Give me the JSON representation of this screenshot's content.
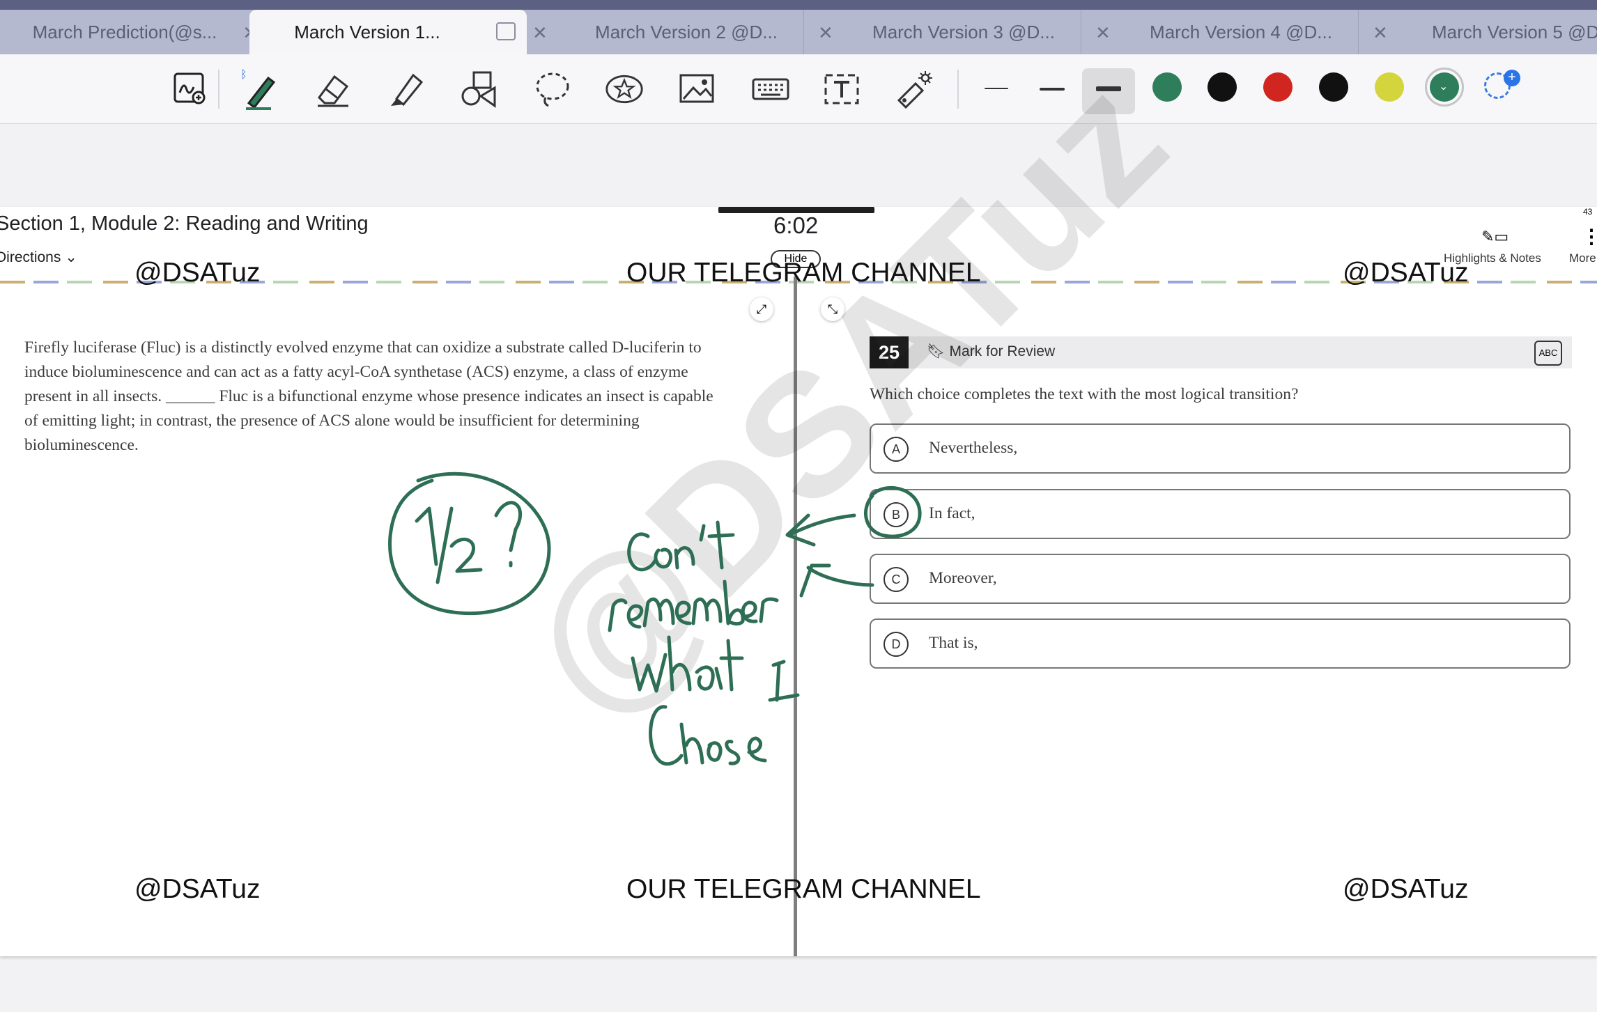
{
  "tabs": [
    {
      "label": "March Prediction(@s...",
      "active": false
    },
    {
      "label": "March Version 1...",
      "active": true
    },
    {
      "label": "March Version 2 @D...",
      "active": false
    },
    {
      "label": "March Version 3 @D...",
      "active": false
    },
    {
      "label": "March Version 4 @D...",
      "active": false
    },
    {
      "label": "March Version 5 @D",
      "active": false
    }
  ],
  "toolbar": {
    "tools": [
      "lasso-handwriting-icon",
      "pen-icon",
      "eraser-icon",
      "highlighter-icon",
      "shapes-icon",
      "lasso-icon",
      "sticker-icon",
      "image-icon",
      "keyboard-icon",
      "text-icon",
      "laser-pointer-icon"
    ],
    "colors": [
      "#2e7d5b",
      "#111111",
      "#d0261f",
      "#111111",
      "#d4d43c",
      "#2e7d5b"
    ],
    "selected_color": "#2e7d5b"
  },
  "exam": {
    "section_title": "Section 1, Module 2: Reading and Writing",
    "directions": "Directions",
    "timer": "6:02",
    "hide": "Hide",
    "highlights_notes": "Highlights & Notes",
    "more": "More",
    "page_num": "43"
  },
  "passage": "Firefly luciferase (Fluc) is a distinctly evolved enzyme that can oxidize a substrate called D-luciferin to induce bioluminescence and can act as a fatty acyl-CoA synthetase (ACS) enzyme, a class of enzyme present in all insects. ______ Fluc is a bifunctional enzyme whose presence indicates an insect is capable of emitting light; in contrast, the presence of ACS alone would be insufficient for determining bioluminescence.",
  "question": {
    "number": "25",
    "mark_for_review": "Mark for Review",
    "abc": "ABC",
    "prompt": "Which choice completes the text with the most logical transition?",
    "choices": [
      {
        "letter": "A",
        "text": "Nevertheless,"
      },
      {
        "letter": "B",
        "text": "In fact,"
      },
      {
        "letter": "C",
        "text": "Moreover,"
      },
      {
        "letter": "D",
        "text": "That is,"
      }
    ]
  },
  "watermarks": {
    "handle": "@DSATuz",
    "channel": "OUR TELEGRAM CHANNEL",
    "diagonal": "@DSATuz"
  },
  "handwriting": {
    "fraction": "1/2 ?",
    "note": "Can't remember what I chose"
  }
}
